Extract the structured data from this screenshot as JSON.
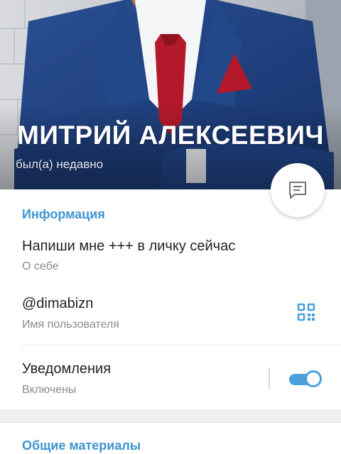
{
  "profile": {
    "name": "МИТРИЙ АЛЕКСЕЕВИЧ",
    "status": "был(а) недавно"
  },
  "fab": {
    "icon": "message-icon"
  },
  "info_section": {
    "title": "Информация",
    "bio": {
      "value": "Напиши мне +++ в личку сейчас",
      "label": "О себе"
    },
    "username": {
      "value": "@dimabizn",
      "label": "Имя пользователя",
      "icon": "qr-code-icon"
    },
    "notifications": {
      "value": "Уведомления",
      "label": "Включены",
      "enabled": true
    }
  },
  "media_section": {
    "title": "Общие материалы"
  },
  "colors": {
    "accent": "#3e95d1",
    "toggle": "#4aa0dd",
    "suit": "#1f3f7c",
    "tie": "#b3192a"
  }
}
